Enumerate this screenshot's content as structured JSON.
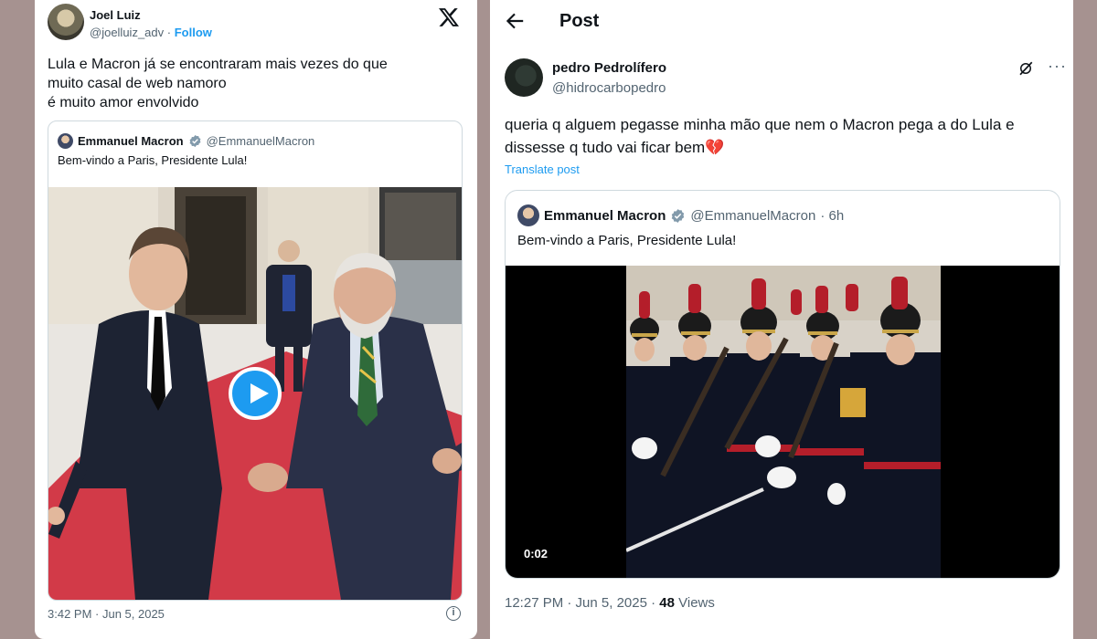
{
  "left_tweet": {
    "author_name": "Joel Luiz",
    "author_handle": "@joelluiz_adv",
    "separator": "·",
    "follow_label": "Follow",
    "text": "Lula e Macron já se encontraram mais vezes do que\nmuito casal de web namoro\né muito amor envolvido",
    "quoted": {
      "name": "Emmanuel Macron",
      "handle": "@EmmanuelMacron",
      "text": "Bem-vindo a Paris, Presidente Lula!"
    },
    "timestamp": "3:42 PM · Jun 5, 2025",
    "info_icon": "i"
  },
  "right_post": {
    "page_title": "Post",
    "author_name": "pedro Pedrolífero",
    "author_handle": "@hidrocarbopedro",
    "more_label": "···",
    "text": "queria q alguem pegasse minha mão que nem o Macron pega a do Lula e dissesse q tudo vai ficar bem💔",
    "translate_label": "Translate post",
    "quoted": {
      "name": "Emmanuel Macron",
      "handle": "@EmmanuelMacron",
      "time": "· 6h",
      "text": "Bem-vindo a Paris, Presidente Lula!"
    },
    "video_duration": "0:02",
    "timestamp": "12:27 PM · Jun 5, 2025 ·",
    "views_count": "48",
    "views_label": "Views"
  },
  "colors": {
    "background": "#a69290",
    "accent": "#1d9bf0",
    "secondary_text": "#536471",
    "border": "#cfd9de",
    "carpet": "#d23a48"
  }
}
